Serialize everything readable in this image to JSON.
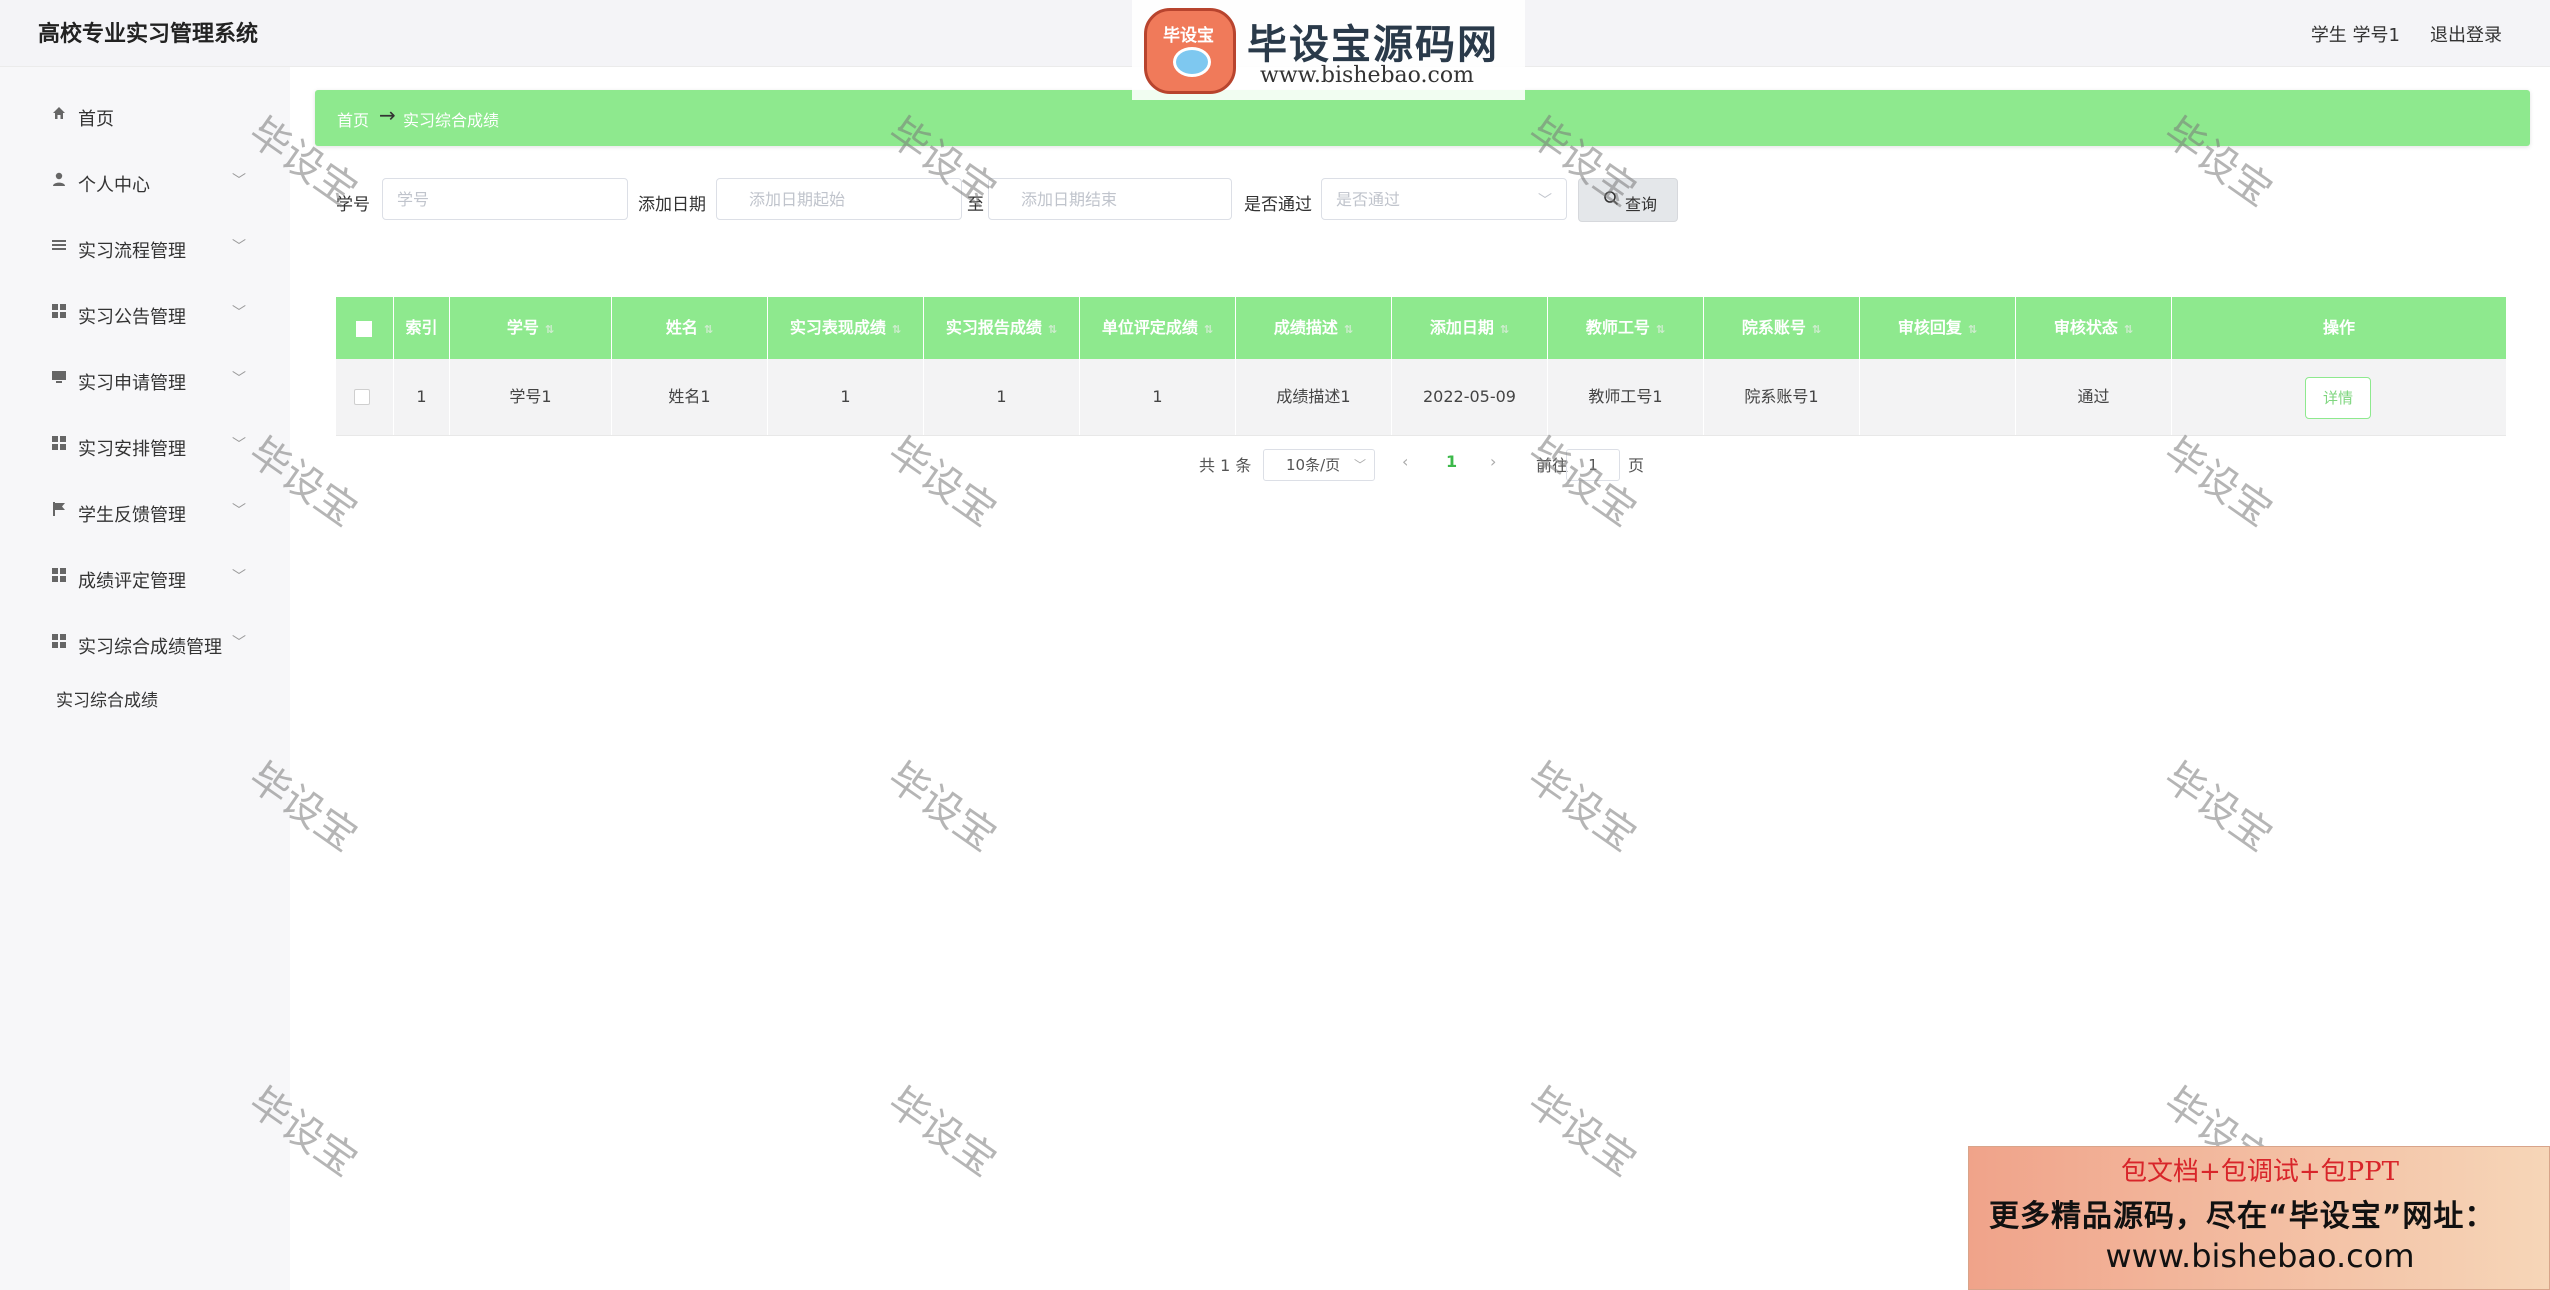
{
  "header": {
    "system_title": "高校专业实习管理系统",
    "user_label": "学生 学号1",
    "logout_label": "退出登录"
  },
  "sidebar": {
    "items": [
      {
        "label": "首页",
        "icon": "home-icon"
      },
      {
        "label": "个人中心",
        "icon": "user-icon"
      },
      {
        "label": "实习流程管理",
        "icon": "list-icon"
      },
      {
        "label": "实习公告管理",
        "icon": "grid-icon"
      },
      {
        "label": "实习申请管理",
        "icon": "monitor-icon"
      },
      {
        "label": "实习安排管理",
        "icon": "grid-icon"
      },
      {
        "label": "学生反馈管理",
        "icon": "flag-icon"
      },
      {
        "label": "成绩评定管理",
        "icon": "grid-icon"
      },
      {
        "label": "实习综合成绩管理",
        "icon": "grid-icon"
      }
    ],
    "submenu_label": "实习综合成绩"
  },
  "breadcrumb": {
    "home": "首页",
    "arrow": "→",
    "current": "实习综合成绩"
  },
  "filters": {
    "student_id_label": "学号",
    "student_id_placeholder": "学号",
    "date_label": "添加日期",
    "date_start_placeholder": "添加日期起始",
    "date_to_label": "至",
    "date_end_placeholder": "添加日期结束",
    "passed_label": "是否通过",
    "passed_placeholder": "是否通过",
    "search_label": "查询"
  },
  "table": {
    "columns": [
      "索引",
      "学号",
      "姓名",
      "实习表现成绩",
      "实习报告成绩",
      "单位评定成绩",
      "成绩描述",
      "添加日期",
      "教师工号",
      "院系账号",
      "审核回复",
      "审核状态",
      "操作"
    ],
    "rows": [
      {
        "index": "1",
        "student_id": "学号1",
        "name": "姓名1",
        "performance": "1",
        "report": "1",
        "unit": "1",
        "desc": "成绩描述1",
        "date": "2022-05-09",
        "teacher": "教师工号1",
        "dept": "院系账号1",
        "reply": "",
        "status": "通过",
        "action": "详情"
      }
    ]
  },
  "pagination": {
    "total": "共 1 条",
    "page_size": "10条/页",
    "current_page": "1",
    "goto_prefix": "前往",
    "goto_value": "1",
    "goto_suffix": "页"
  },
  "watermark_text": "毕设宝",
  "logo": {
    "emblem_text": "毕设宝",
    "title": "毕设宝源码网",
    "url": "www.bishebao.com"
  },
  "ad": {
    "line1": "包文档+包调试+包PPT",
    "line2": "更多精品源码，尽在“毕设宝”网址：",
    "line3": "www.bishebao.com"
  },
  "colors": {
    "accent_green": "#8ee98e",
    "page_number_green": "#3cb94a"
  }
}
